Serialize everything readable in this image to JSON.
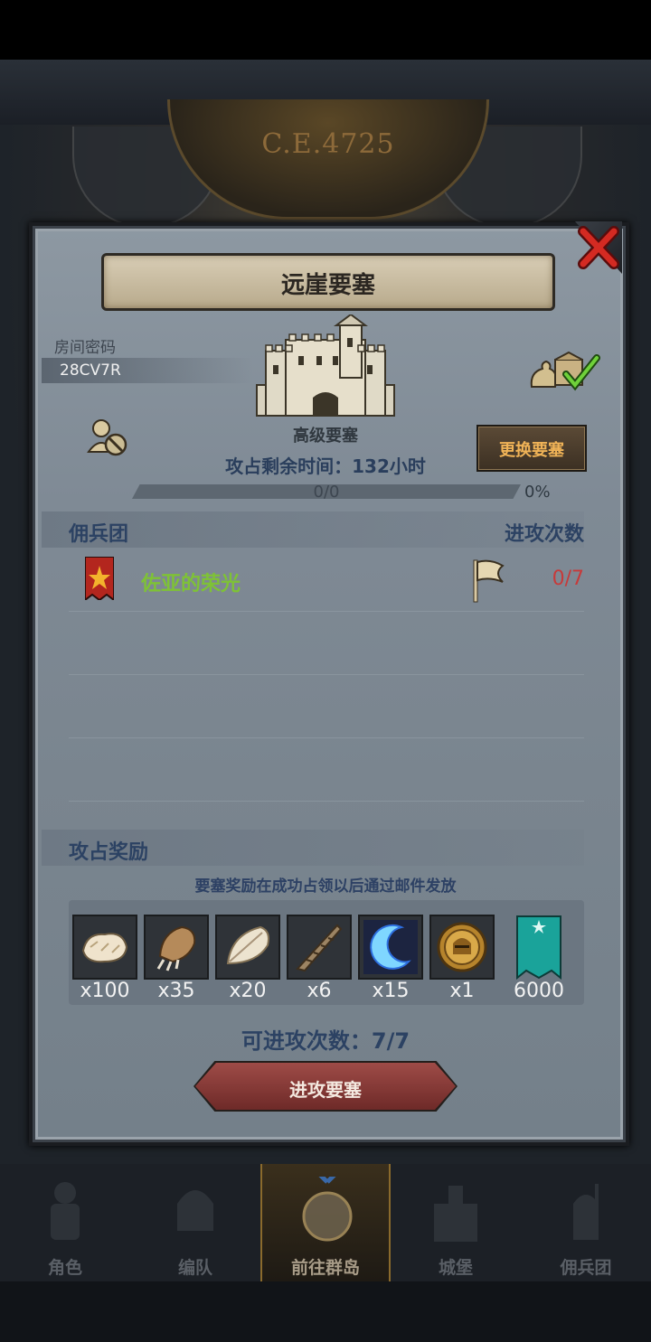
{
  "background": {
    "era_label": "C.E.4725"
  },
  "dialog": {
    "title": "远崖要塞",
    "room_code_label": "房间密码",
    "room_code": "28CV7R",
    "fortress_grade": "高级要塞",
    "time_remaining": "攻占剩余时间：132小时",
    "progress_text": "0/0",
    "progress_fraction": 0,
    "progress_percent": "0%",
    "change_button": "更换要塞",
    "mercenary_header": "佣兵团",
    "attacks_header": "进攻次数",
    "guild": {
      "name": "佐亚的荣光",
      "attacks": "0/7"
    },
    "rewards_header": "攻占奖励",
    "rewards_note": "要塞奖励在成功占领以后通过邮件发放",
    "rewards": [
      {
        "icon": "fur-pelt-icon",
        "qty": "x100"
      },
      {
        "icon": "beast-claw-icon",
        "qty": "x35"
      },
      {
        "icon": "feather-icon",
        "qty": "x20"
      },
      {
        "icon": "horn-icon",
        "qty": "x6"
      },
      {
        "icon": "blue-crescent-icon",
        "qty": "x15"
      },
      {
        "icon": "golden-helmet-coin-icon",
        "qty": "x1"
      },
      {
        "icon": "moon-banner-icon",
        "qty": "6000"
      }
    ],
    "remaining_attempts": "可进攻次数：7/7",
    "attack_button": "进攻要塞"
  },
  "nav": [
    {
      "label": "角色",
      "icon": "knight-icon"
    },
    {
      "label": "编队",
      "icon": "helmet-icon"
    },
    {
      "label": "前往群岛",
      "icon": "globe-icon",
      "active": true
    },
    {
      "label": "城堡",
      "icon": "castle-icon"
    },
    {
      "label": "佣兵团",
      "icon": "mercenary-icon"
    }
  ],
  "colors": {
    "panel": "#7f8a95",
    "guild_name": "#7ec236",
    "attack_count": "#c73a3a",
    "header_text": "#2c4263",
    "change_button_text": "#f0b357"
  }
}
